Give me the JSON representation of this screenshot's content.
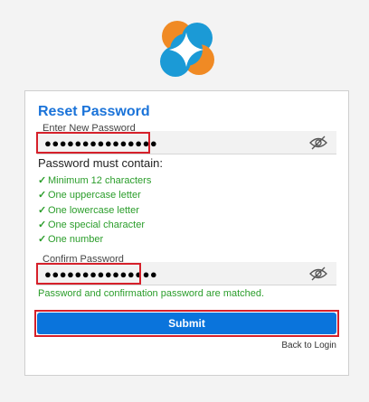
{
  "brand": {
    "logo_icon": "app-logo-icon",
    "accent": "#1a73d9",
    "orange": "#f08a24",
    "blue": "#1b9ad6"
  },
  "form": {
    "title": "Reset Password",
    "new_password": {
      "label": "Enter New Password",
      "value": "●●●●●●●●●●●●●●●",
      "toggle_icon": "eye-off-icon"
    },
    "requirements_heading": "Password must contain:",
    "requirements": [
      {
        "check": "✓",
        "text": "Minimum 12 characters"
      },
      {
        "check": "✓",
        "text": "One uppercase letter"
      },
      {
        "check": "✓",
        "text": "One lowercase letter"
      },
      {
        "check": "✓",
        "text": "One special character"
      },
      {
        "check": "✓",
        "text": "One number"
      }
    ],
    "confirm_password": {
      "label": "Confirm Password",
      "value": "●●●●●●●●●●●●●●●",
      "toggle_icon": "eye-off-icon"
    },
    "match_message": "Password and confirmation password are matched.",
    "submit_label": "Submit",
    "back_link": "Back to Login"
  },
  "colors": {
    "success": "#2a9d2a",
    "primary_button": "#0a74dc",
    "highlight": "#d6202a"
  }
}
